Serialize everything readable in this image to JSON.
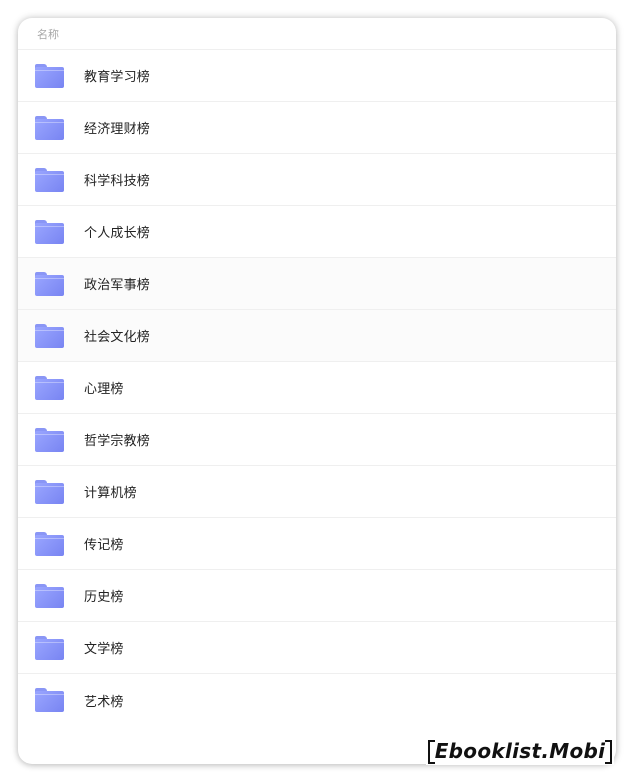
{
  "header": {
    "column_name": "名称"
  },
  "folder_icon_color": "#8a96f5",
  "items": [
    {
      "label": "教育学习榜",
      "icon": "folder-icon"
    },
    {
      "label": "经济理财榜",
      "icon": "folder-icon"
    },
    {
      "label": "科学科技榜",
      "icon": "folder-icon"
    },
    {
      "label": "个人成长榜",
      "icon": "folder-icon"
    },
    {
      "label": "政治军事榜",
      "icon": "folder-icon"
    },
    {
      "label": "社会文化榜",
      "icon": "folder-icon"
    },
    {
      "label": "心理榜",
      "icon": "folder-icon"
    },
    {
      "label": "哲学宗教榜",
      "icon": "folder-icon"
    },
    {
      "label": "计算机榜",
      "icon": "folder-icon"
    },
    {
      "label": "传记榜",
      "icon": "folder-icon"
    },
    {
      "label": "历史榜",
      "icon": "folder-icon"
    },
    {
      "label": "文学榜",
      "icon": "folder-icon"
    },
    {
      "label": "艺术榜",
      "icon": "folder-icon"
    }
  ],
  "watermark": {
    "text": "Ebooklist.Mobi"
  }
}
